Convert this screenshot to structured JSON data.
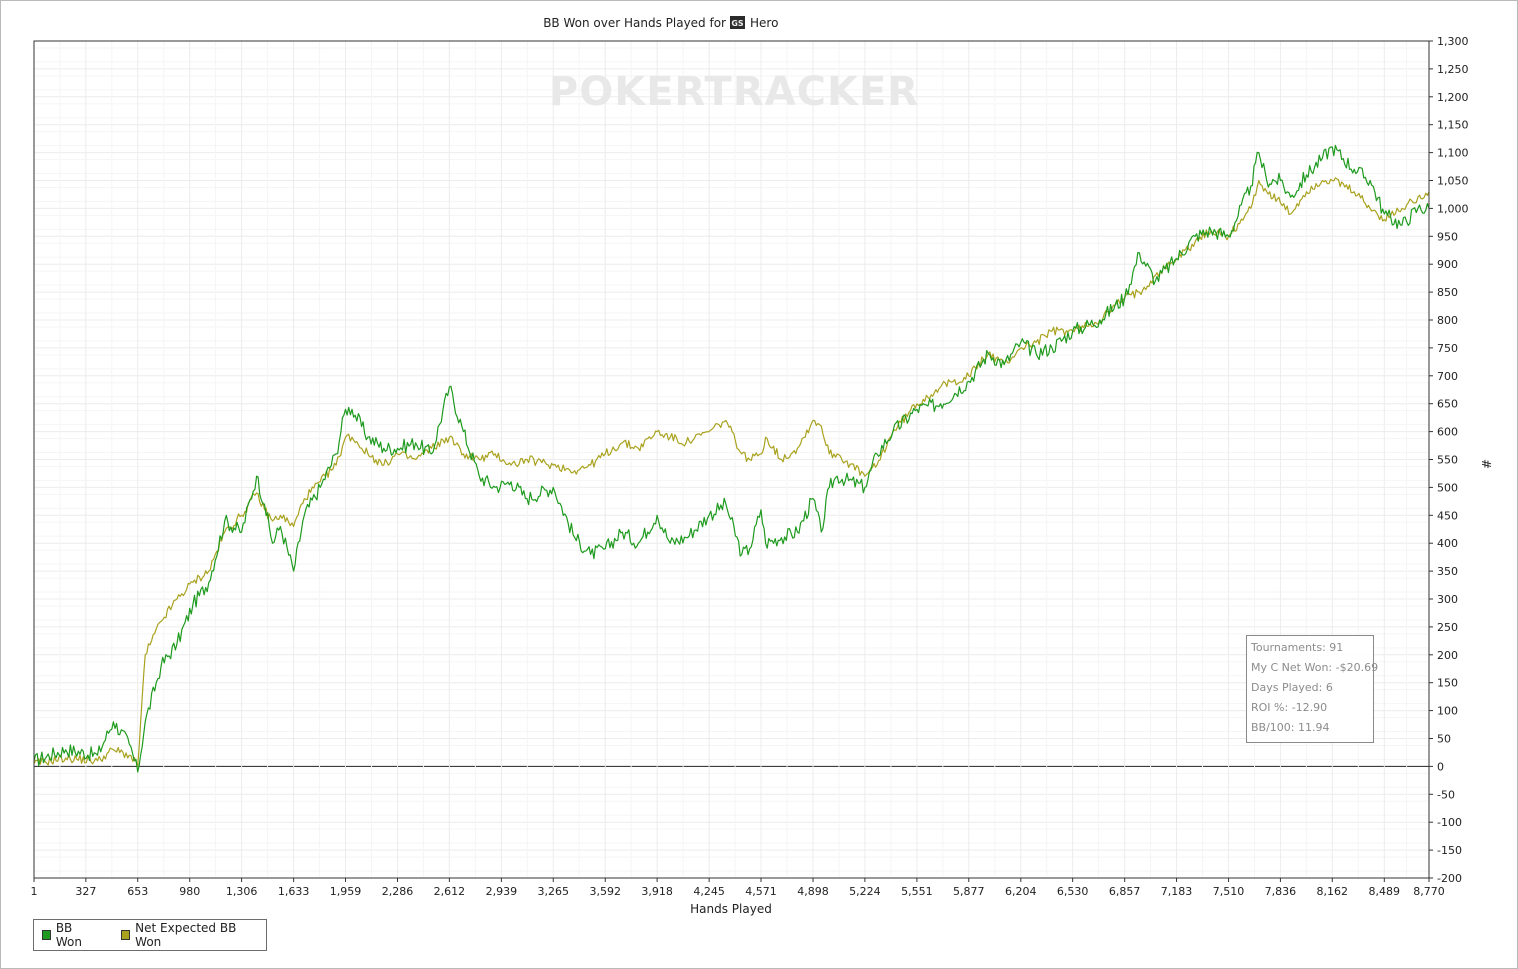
{
  "chart_data": {
    "type": "line",
    "title_prefix": "BB Won over Hands Played for",
    "title_badge": "GS",
    "title_player": "Hero",
    "watermark": "POKERTRACKER",
    "xlabel": "Hands Played",
    "ylabel": "#",
    "xlim": [
      1,
      8770
    ],
    "ylim": [
      -200,
      1300
    ],
    "x_ticks": [
      "1",
      "327",
      "653",
      "980",
      "1,306",
      "1,633",
      "1,959",
      "2,286",
      "2,612",
      "2,939",
      "3,265",
      "3,592",
      "3,918",
      "4,245",
      "4,571",
      "4,898",
      "5,224",
      "5,551",
      "5,877",
      "6,204",
      "6,530",
      "6,857",
      "7,183",
      "7,510",
      "7,836",
      "8,162",
      "8,489",
      "8,770"
    ],
    "y_ticks": [
      "1,300",
      "1,250",
      "1,200",
      "1,150",
      "1,100",
      "1,050",
      "1,000",
      "950",
      "900",
      "850",
      "800",
      "750",
      "700",
      "650",
      "600",
      "550",
      "500",
      "450",
      "400",
      "350",
      "300",
      "250",
      "200",
      "150",
      "100",
      "50",
      "0",
      "-50",
      "-100",
      "-150",
      "-200"
    ],
    "grid": true,
    "legend_position": "bottom-left",
    "series": [
      {
        "name": "BB Won",
        "color": "#1e9a1e",
        "x": [
          1,
          200,
          400,
          500,
          600,
          653,
          700,
          800,
          900,
          1000,
          1100,
          1200,
          1306,
          1400,
          1450,
          1500,
          1550,
          1633,
          1700,
          1800,
          1900,
          1959,
          2000,
          2100,
          2200,
          2286,
          2400,
          2500,
          2612,
          2700,
          2800,
          2900,
          3000,
          3100,
          3265,
          3400,
          3500,
          3592,
          3700,
          3800,
          3918,
          4000,
          4100,
          4245,
          4350,
          4450,
          4500,
          4571,
          4600,
          4700,
          4800,
          4898,
          4950,
          5000,
          5050,
          5224,
          5300,
          5400,
          5551,
          5700,
          5877,
          6000,
          6100,
          6204,
          6300,
          6400,
          6530,
          6700,
          6857,
          6950,
          7050,
          7183,
          7300,
          7400,
          7510,
          7650,
          7700,
          7750,
          7836,
          7900,
          8000,
          8100,
          8162,
          8300,
          8400,
          8489,
          8600,
          8700,
          8770
        ],
        "values": [
          10,
          30,
          20,
          80,
          40,
          -10,
          80,
          180,
          220,
          290,
          330,
          440,
          420,
          520,
          470,
          400,
          430,
          350,
          450,
          500,
          560,
          640,
          640,
          590,
          570,
          570,
          580,
          560,
          680,
          600,
          520,
          500,
          510,
          480,
          500,
          410,
          380,
          390,
          420,
          400,
          450,
          400,
          410,
          450,
          470,
          380,
          390,
          460,
          400,
          410,
          420,
          480,
          420,
          500,
          520,
          500,
          560,
          600,
          640,
          650,
          690,
          740,
          720,
          760,
          740,
          750,
          780,
          800,
          840,
          920,
          870,
          910,
          950,
          960,
          950,
          1040,
          1100,
          1050,
          1050,
          1020,
          1060,
          1090,
          1110,
          1070,
          1050,
          990,
          970,
          1000,
          1000
        ]
      },
      {
        "name": "Net Expected BB Won",
        "color": "#a9a21f",
        "x": [
          1,
          200,
          400,
          500,
          600,
          653,
          700,
          800,
          900,
          1000,
          1100,
          1200,
          1306,
          1400,
          1450,
          1500,
          1550,
          1633,
          1700,
          1800,
          1900,
          1959,
          2000,
          2100,
          2200,
          2286,
          2400,
          2500,
          2612,
          2700,
          2800,
          2900,
          3000,
          3100,
          3265,
          3400,
          3500,
          3592,
          3700,
          3800,
          3918,
          4000,
          4100,
          4245,
          4350,
          4450,
          4500,
          4571,
          4600,
          4700,
          4800,
          4898,
          4950,
          5000,
          5050,
          5224,
          5300,
          5400,
          5551,
          5700,
          5877,
          6000,
          6100,
          6204,
          6300,
          6400,
          6530,
          6700,
          6857,
          6950,
          7050,
          7183,
          7300,
          7400,
          7510,
          7650,
          7700,
          7750,
          7836,
          7900,
          8000,
          8100,
          8162,
          8300,
          8400,
          8489,
          8600,
          8700,
          8770
        ],
        "values": [
          5,
          15,
          10,
          30,
          20,
          0,
          200,
          260,
          300,
          330,
          350,
          420,
          450,
          490,
          460,
          440,
          450,
          430,
          480,
          510,
          540,
          590,
          590,
          560,
          540,
          560,
          550,
          570,
          590,
          560,
          550,
          560,
          540,
          550,
          540,
          530,
          540,
          560,
          580,
          570,
          600,
          590,
          580,
          600,
          620,
          560,
          550,
          560,
          590,
          550,
          570,
          620,
          610,
          560,
          560,
          520,
          540,
          600,
          650,
          680,
          700,
          740,
          720,
          750,
          760,
          780,
          780,
          800,
          840,
          850,
          880,
          910,
          940,
          960,
          950,
          1000,
          1050,
          1030,
          1010,
          990,
          1030,
          1050,
          1050,
          1030,
          1000,
          980,
          1000,
          1020,
          1030
        ]
      }
    ]
  },
  "stats": {
    "tournaments": "Tournaments: 91",
    "net_won": "My C Net Won: -$20.69",
    "days_played": "Days Played: 6",
    "roi": "ROI %: -12.90",
    "bb_100": "BB/100: 11.94"
  }
}
